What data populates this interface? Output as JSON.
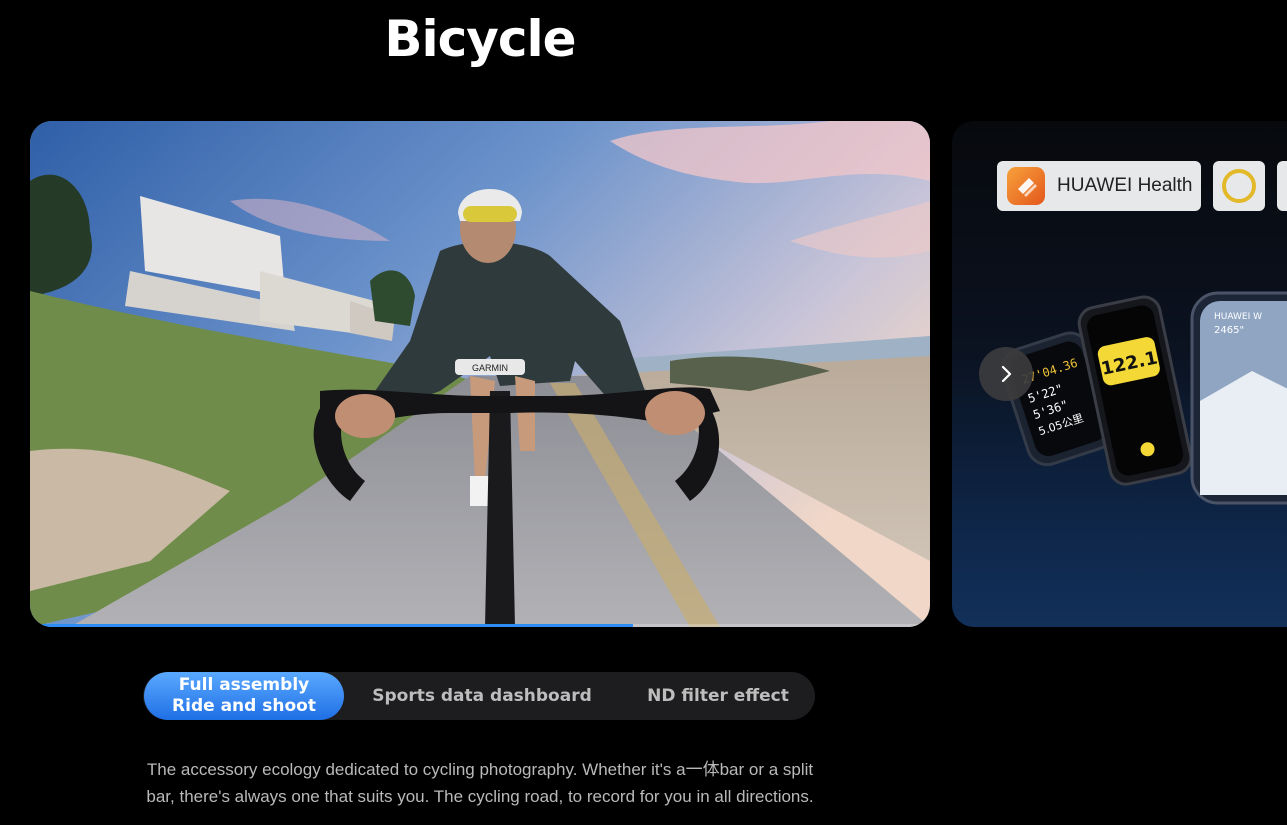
{
  "header": {
    "title": "Bicycle"
  },
  "carousel": {
    "main_card": {
      "progress": 0.67
    },
    "side_card": {
      "chips": [
        {
          "label": "HUAWEI Health",
          "icon": "huawei-health-icon",
          "color": "#ee7a2a"
        },
        {
          "icon": "ring-icon",
          "color": "#e3b92a"
        }
      ],
      "watch_readouts": [
        "122.1",
        "27'04.36",
        "5'22\"",
        "5'36\"",
        "5.05公里",
        "HUAWEI W",
        "2465\""
      ],
      "next_icon": "chevron-right-icon"
    }
  },
  "tabs": [
    {
      "label_line1": "Full assembly",
      "label_line2": "Ride and shoot",
      "active": true
    },
    {
      "label": "Sports data dashboard",
      "active": false
    },
    {
      "label": "ND filter effect",
      "active": false
    }
  ],
  "description": {
    "line1": "The accessory ecology dedicated to cycling photography. Whether it's a一体bar or a split",
    "line2": "bar, there's always one that suits you. The cycling road, to record for you in all directions."
  },
  "colors": {
    "accent": "#2e8df2",
    "background": "#000000"
  }
}
